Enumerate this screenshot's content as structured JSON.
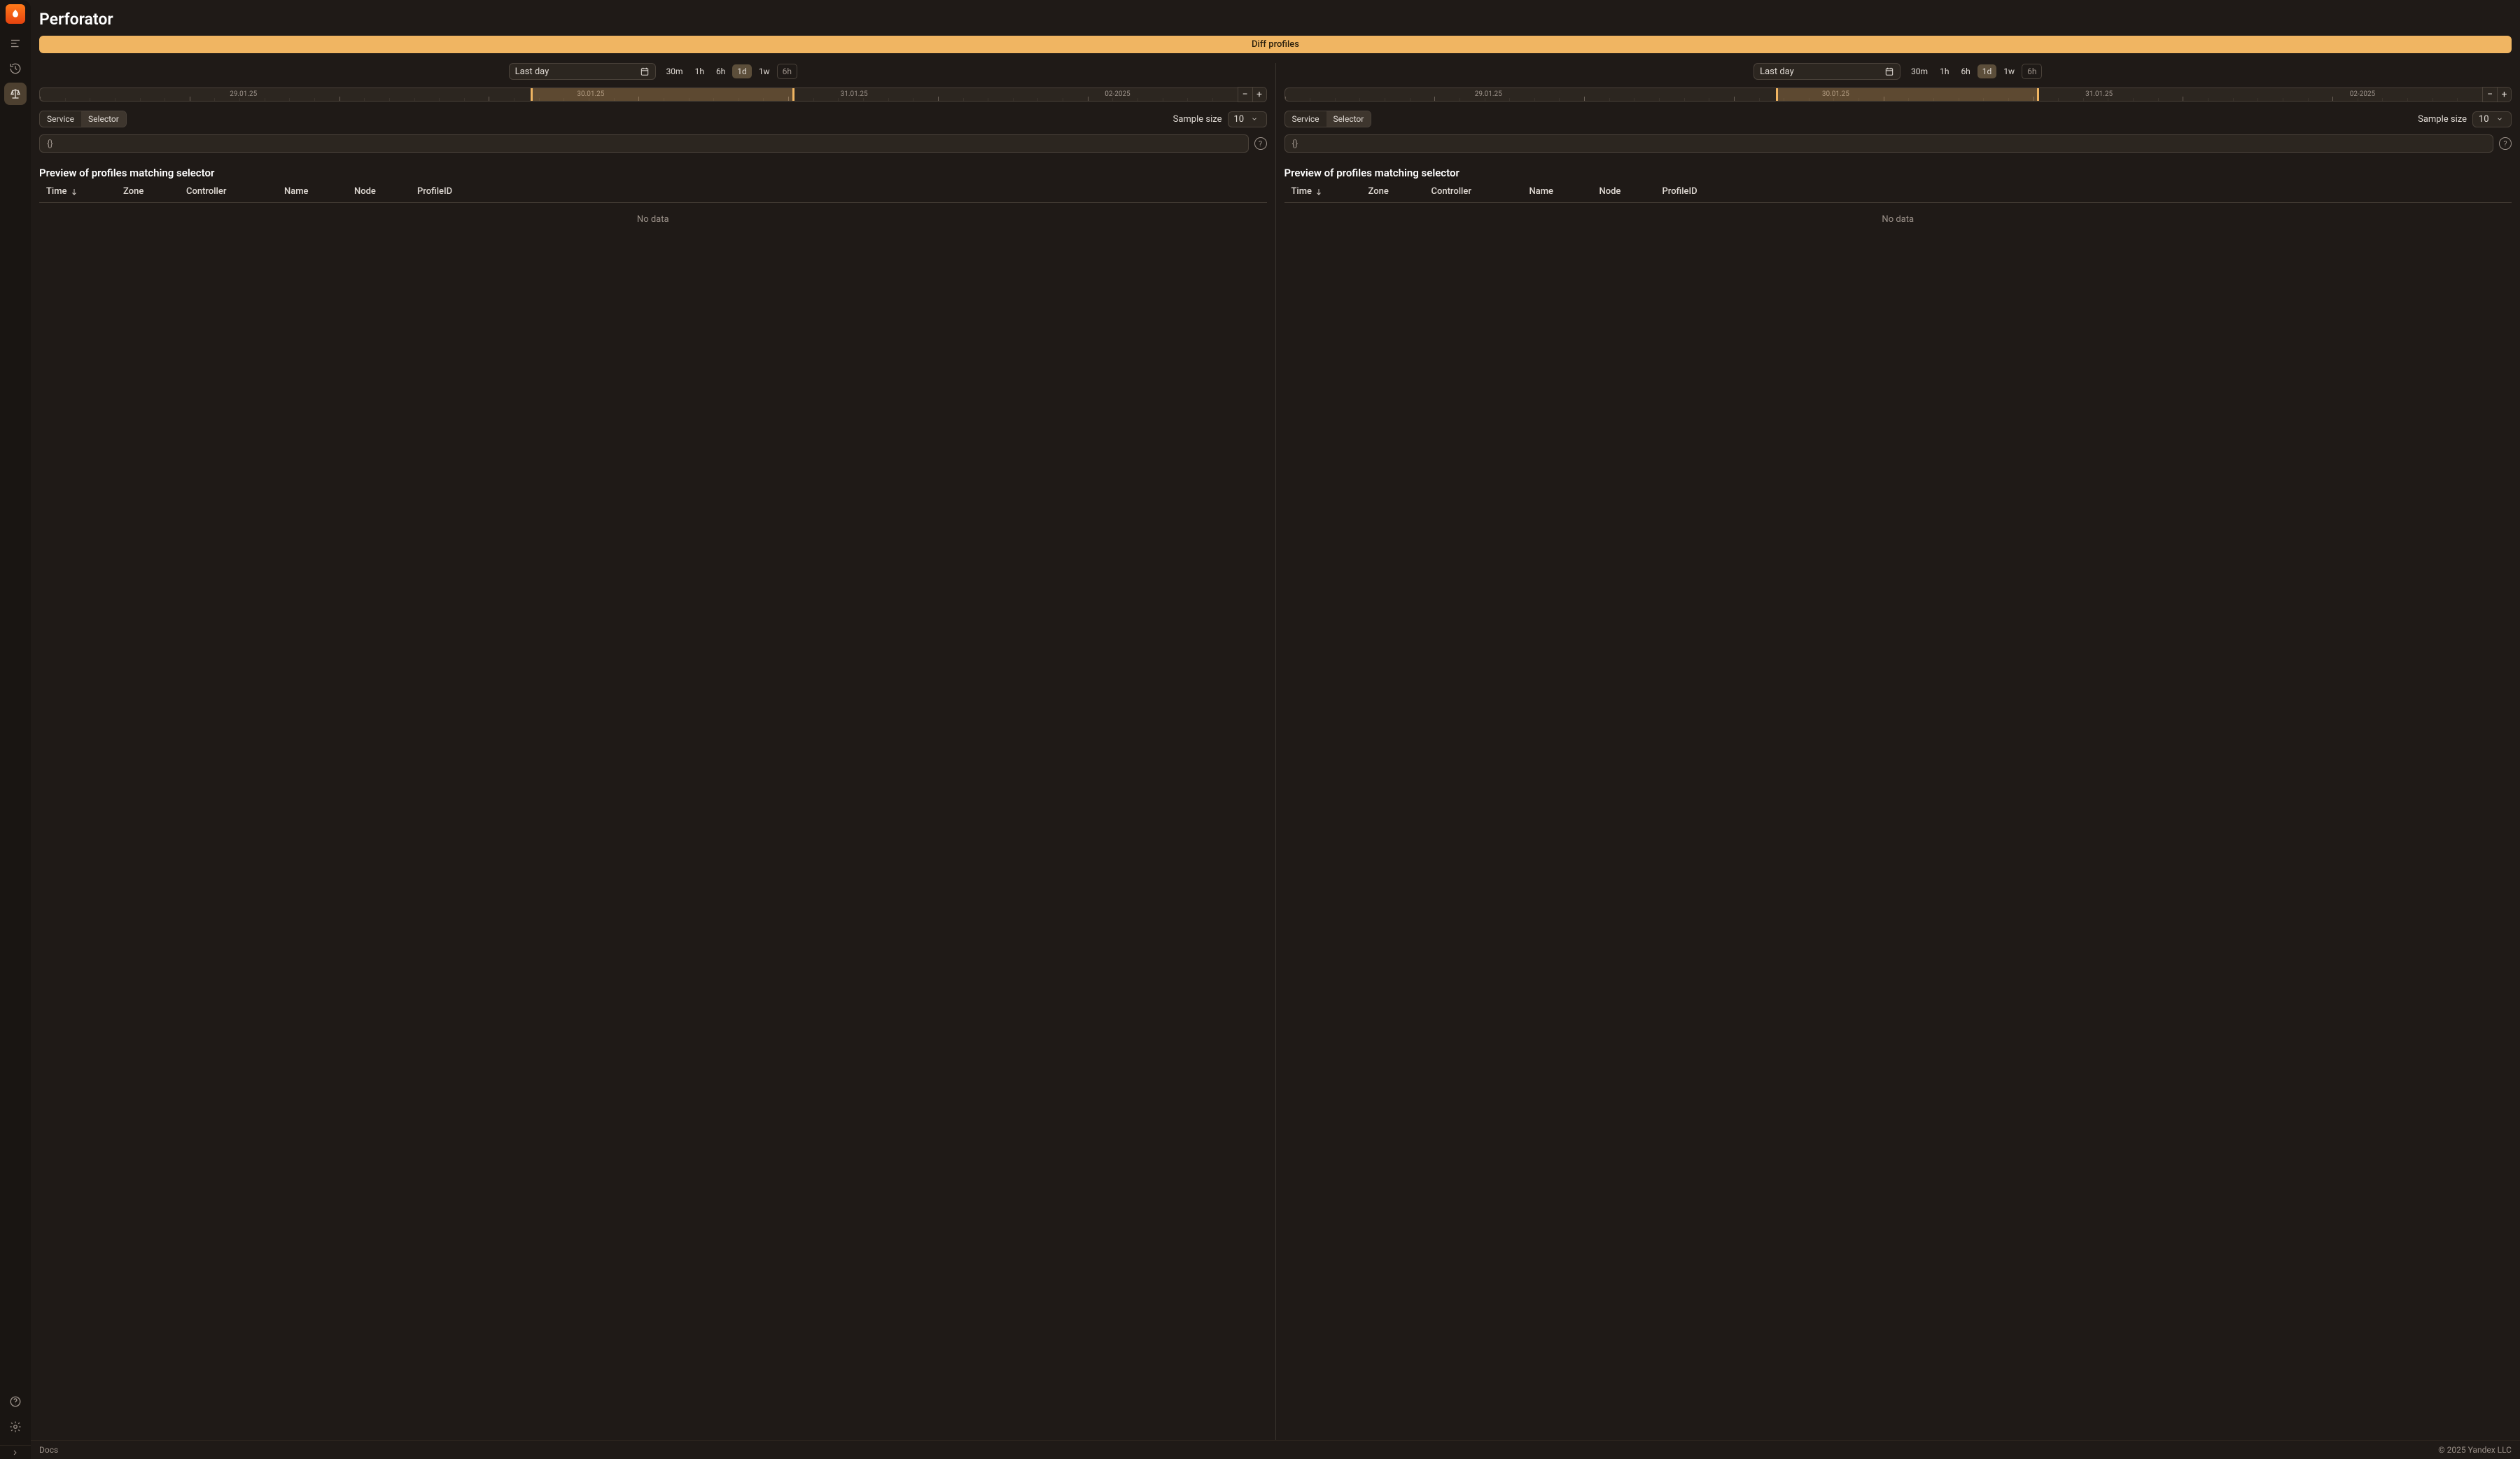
{
  "app_title": "Perforator",
  "banner": "Diff profiles",
  "sidebar": {
    "items": [
      {
        "name": "bars",
        "active": false
      },
      {
        "name": "history",
        "active": false
      },
      {
        "name": "balance",
        "active": true
      }
    ],
    "bottom": [
      {
        "name": "help"
      },
      {
        "name": "settings"
      }
    ]
  },
  "panels": [
    {
      "date_label": "Last day",
      "ranges": [
        "30m",
        "1h",
        "6h",
        "1d",
        "1w",
        "6h"
      ],
      "range_active": "1d",
      "range_disabled": "6h",
      "timeline_labels": [
        {
          "text": "29.01.25",
          "pos": 17
        },
        {
          "text": "30.01.25",
          "pos": 46
        },
        {
          "text": "31.01.25",
          "pos": 68
        },
        {
          "text": "02-2025",
          "pos": 90
        }
      ],
      "timeline_sel": {
        "start": 41,
        "end": 63
      },
      "seg": {
        "service": "Service",
        "selector": "Selector",
        "active": "Selector"
      },
      "sample_label": "Sample size",
      "sample_value": "10",
      "selector_placeholder": "{}",
      "preview_heading": "Preview of profiles matching selector",
      "columns": [
        "Time",
        "Zone",
        "Controller",
        "Name",
        "Node",
        "ProfileID"
      ],
      "sort_col": "Time",
      "no_data": "No data"
    },
    {
      "date_label": "Last day",
      "ranges": [
        "30m",
        "1h",
        "6h",
        "1d",
        "1w",
        "6h"
      ],
      "range_active": "1d",
      "range_disabled": "6h",
      "timeline_labels": [
        {
          "text": "29.01.25",
          "pos": 17
        },
        {
          "text": "30.01.25",
          "pos": 46
        },
        {
          "text": "31.01.25",
          "pos": 68
        },
        {
          "text": "02-2025",
          "pos": 90
        }
      ],
      "timeline_sel": {
        "start": 41,
        "end": 63
      },
      "seg": {
        "service": "Service",
        "selector": "Selector",
        "active": "Selector"
      },
      "sample_label": "Sample size",
      "sample_value": "10",
      "selector_placeholder": "{}",
      "preview_heading": "Preview of profiles matching selector",
      "columns": [
        "Time",
        "Zone",
        "Controller",
        "Name",
        "Node",
        "ProfileID"
      ],
      "sort_col": "Time",
      "no_data": "No data"
    }
  ],
  "footer": {
    "docs": "Docs",
    "copyright": "© 2025 Yandex LLC"
  }
}
